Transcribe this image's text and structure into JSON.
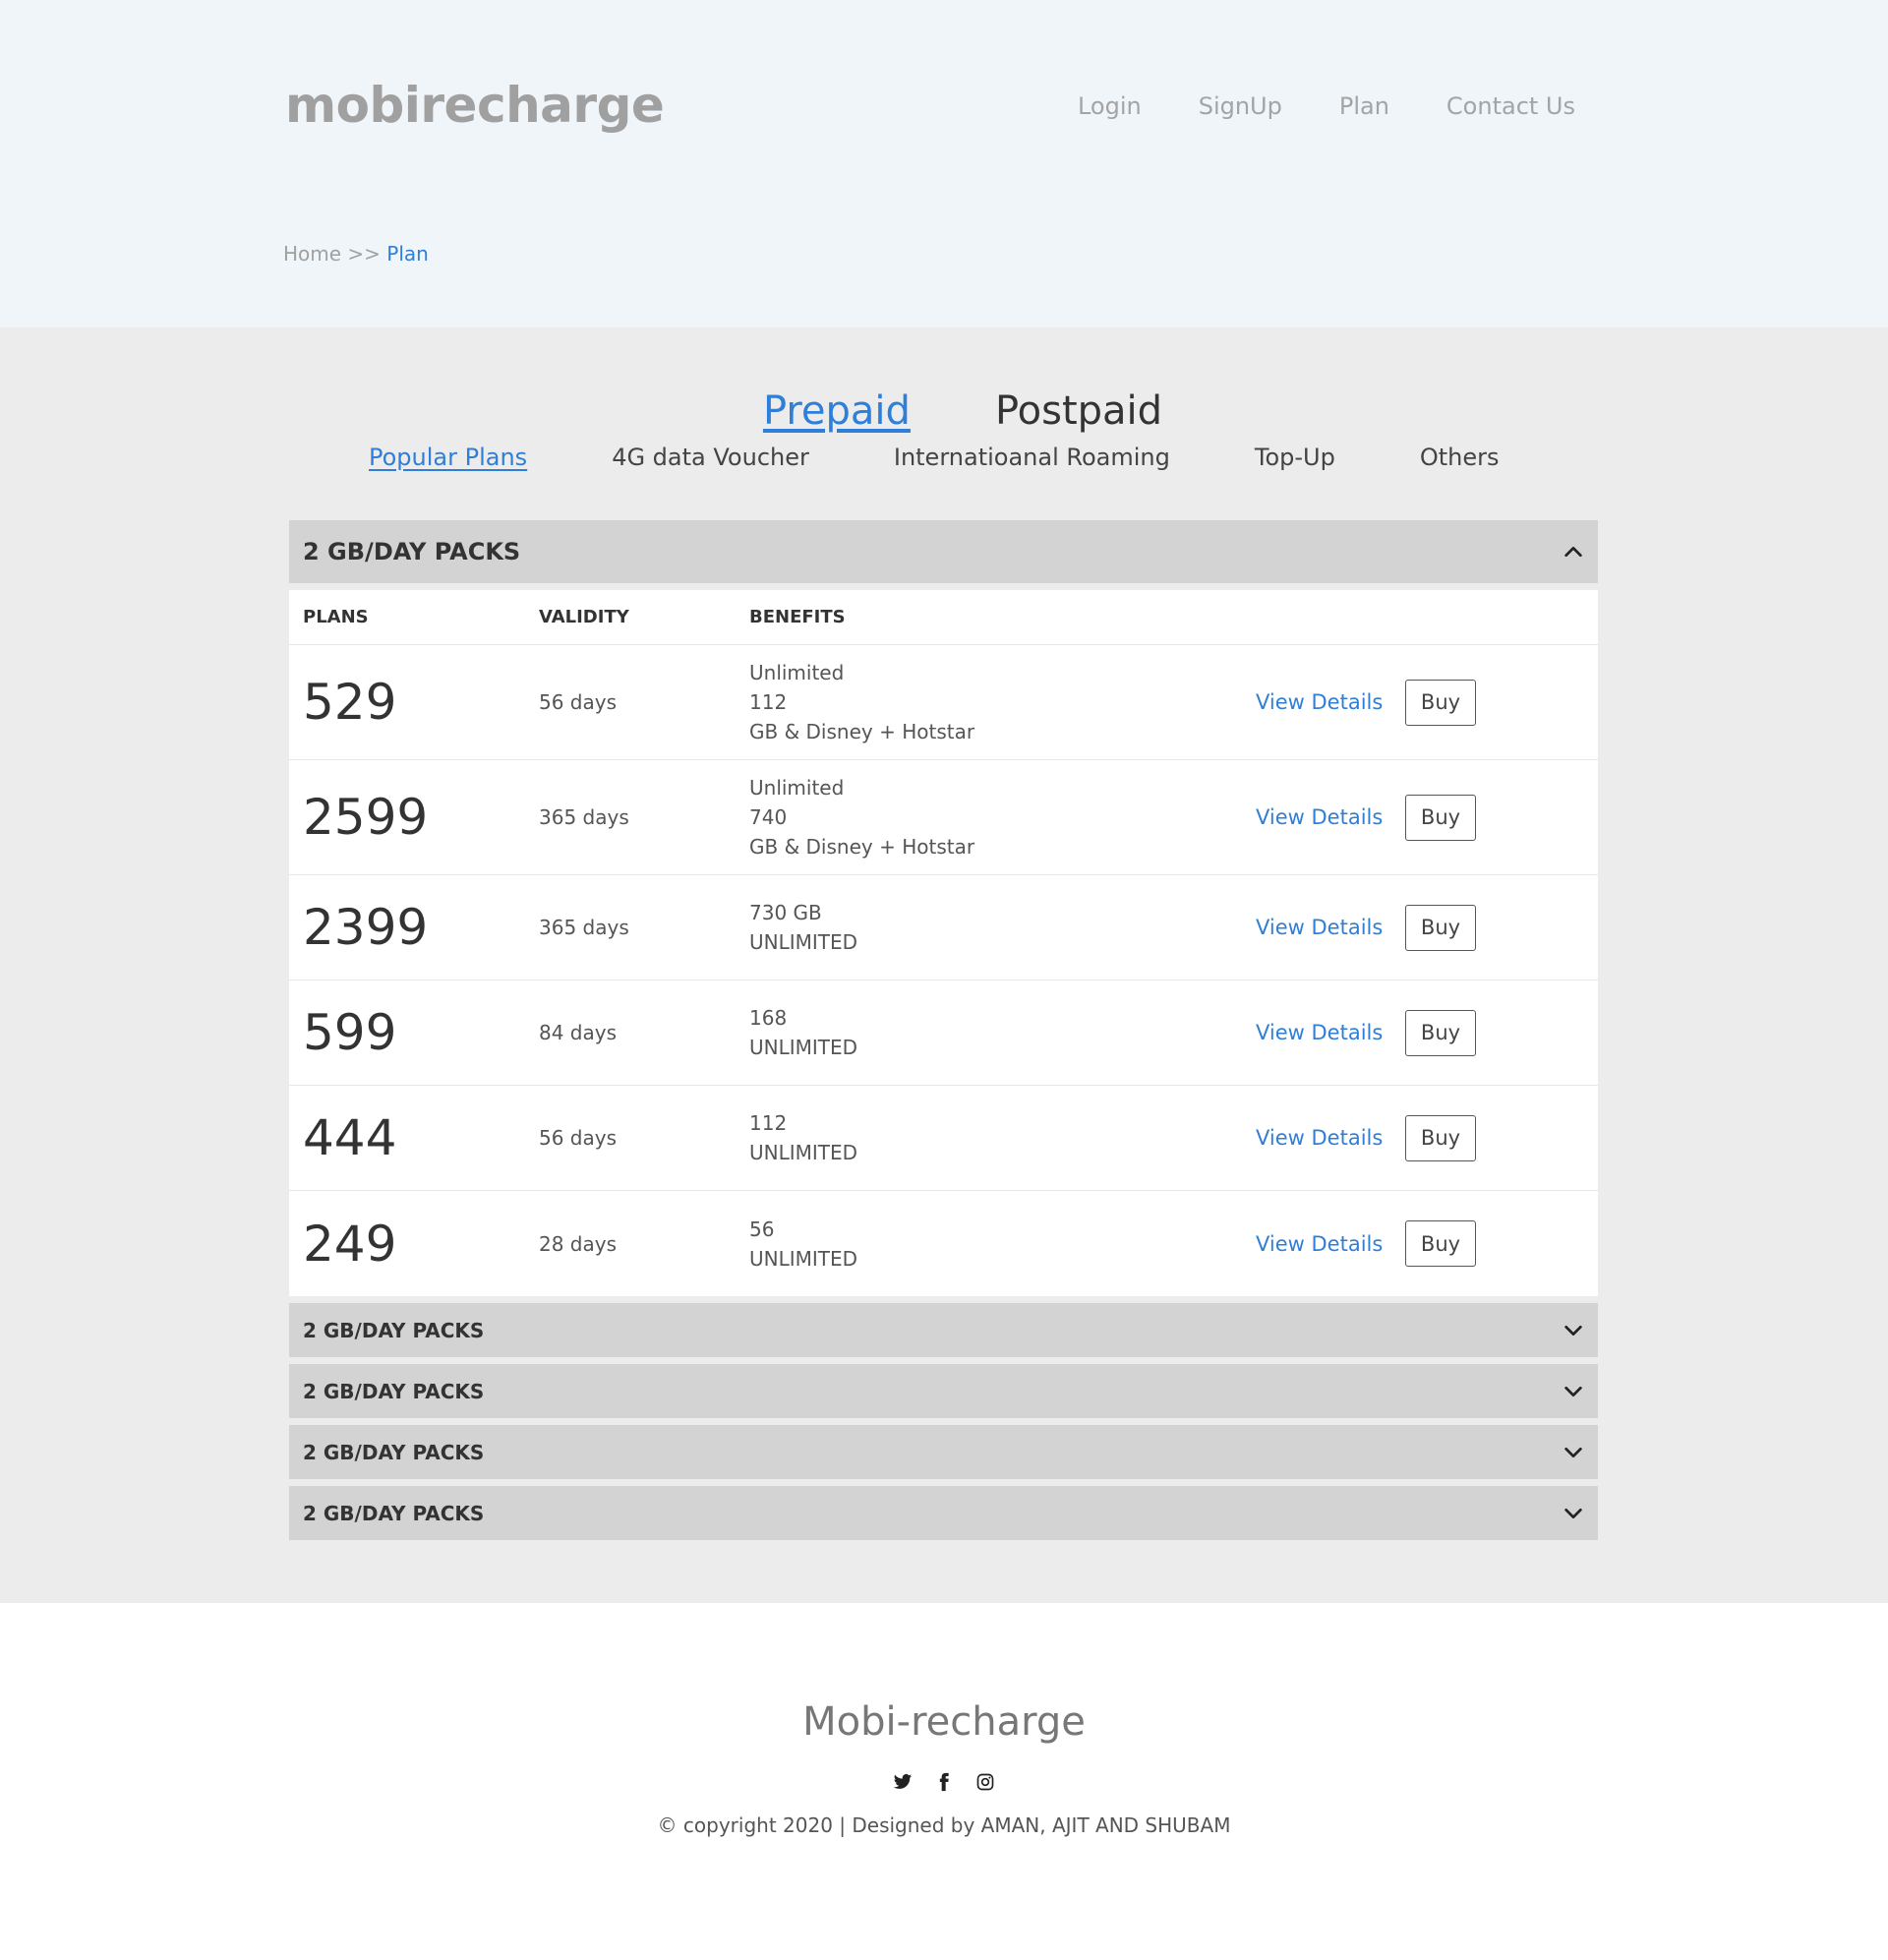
{
  "header": {
    "logo": "mobirecharge",
    "nav": [
      "Login",
      "SignUp",
      "Plan",
      "Contact Us"
    ],
    "breadcrumb": {
      "home": "Home",
      "separator": ">>",
      "current": "Plan"
    }
  },
  "tabs": {
    "main": [
      "Prepaid",
      "Postpaid"
    ],
    "active_main": "Prepaid",
    "sub": [
      "Popular Plans",
      "4G data Voucher",
      "Internatioanal Roaming",
      "Top-Up",
      "Others"
    ],
    "active_sub": "Popular Plans"
  },
  "open_section": {
    "title": "2 GB/DAY PACKS",
    "columns": [
      "PLANS",
      "VALIDITY",
      "BENEFITS"
    ],
    "view_label": "View Details",
    "buy_label": "Buy",
    "plans": [
      {
        "price": "529",
        "validity": "56 days",
        "benefits": [
          "Unlimited",
          "112",
          "GB & Disney + Hotstar"
        ]
      },
      {
        "price": "2599",
        "validity": "365 days",
        "benefits": [
          "Unlimited",
          "740",
          "GB & Disney + Hotstar"
        ]
      },
      {
        "price": "2399",
        "validity": "365 days",
        "benefits": [
          "730 GB",
          "UNLIMITED"
        ]
      },
      {
        "price": "599",
        "validity": "84 days",
        "benefits": [
          "168",
          "UNLIMITED"
        ]
      },
      {
        "price": "444",
        "validity": "56 days",
        "benefits": [
          "112",
          "UNLIMITED"
        ]
      },
      {
        "price": "249",
        "validity": "28 days",
        "benefits": [
          "56",
          "UNLIMITED"
        ]
      }
    ]
  },
  "closed_sections": [
    "2 GB/DAY PACKS",
    "2 GB/DAY PACKS",
    "2 GB/DAY PACKS",
    "2 GB/DAY PACKS"
  ],
  "footer": {
    "brand": "Mobi-recharge",
    "socials": [
      "twitter-icon",
      "facebook-icon",
      "instagram-icon"
    ],
    "copyright": "© copyright 2020 | Designed by AMAN, AJIT AND SHUBAM"
  },
  "colors": {
    "accent": "#2f7fd8",
    "header_bg": "#f0f5f9",
    "main_bg": "#ececec",
    "section_bg": "#d3d3d3"
  }
}
